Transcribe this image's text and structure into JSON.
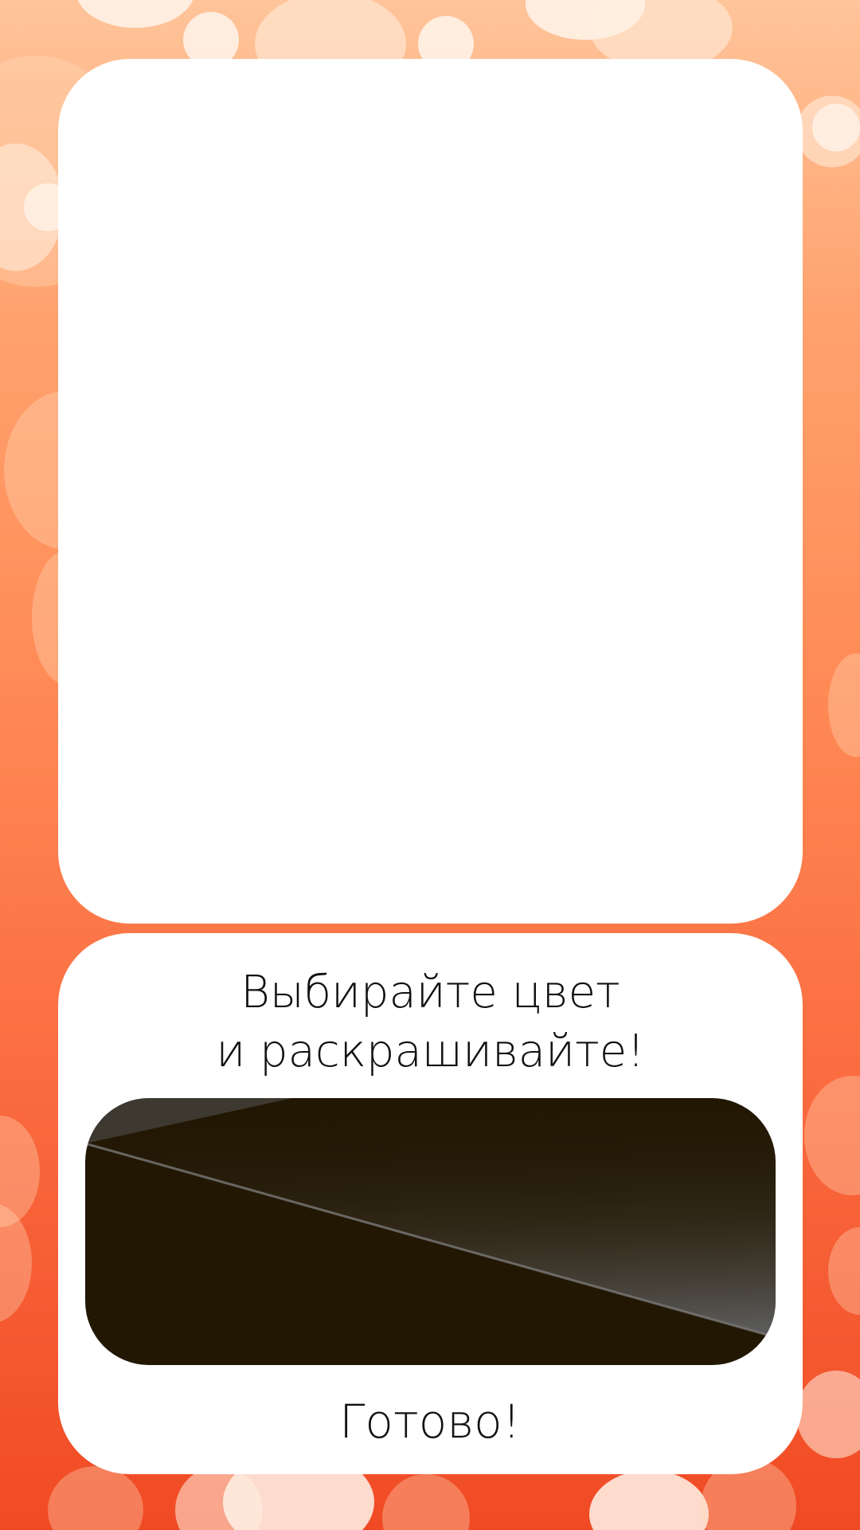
{
  "instruction": {
    "line1": "Выбирайте цвет",
    "line2": "и раскрашивайте!"
  },
  "color_picker": {
    "selected_color": "#221703"
  },
  "done_button": {
    "label": "Готово!"
  },
  "colors": {
    "background_top": "#ffc49a",
    "background_bottom": "#f04a24",
    "panel": "#ffffff",
    "text": "#111111"
  }
}
